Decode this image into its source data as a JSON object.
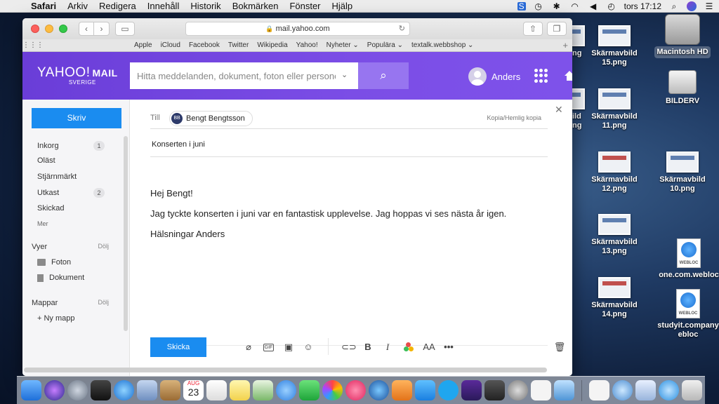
{
  "menubar": {
    "app": "Safari",
    "items": [
      "Arkiv",
      "Redigera",
      "Innehåll",
      "Historik",
      "Bokmärken",
      "Fönster",
      "Hjälp"
    ],
    "clock": "tors 17:12"
  },
  "desktop": {
    "icons": [
      {
        "label1": "Skärmavbild",
        "label2": "15.png"
      },
      {
        "label1": "Skärmavbild",
        "label2": "11.png"
      },
      {
        "label1": "Skärmavbild",
        "label2": "12.png"
      },
      {
        "label1": "Skärmavbild",
        "label2": "13.png"
      },
      {
        "label1": "Skärmavbild",
        "label2": "14.png"
      },
      {
        "label1": "Skärmavbild",
        "label2": "10.png"
      }
    ],
    "partial": [
      "ng",
      "ild",
      "ng"
    ],
    "drive": "Macintosh HD",
    "external": "BILDERV",
    "webloc1": "one.com.webloc",
    "webloc2_line1": "studyit.company",
    "webloc2_line2": "ebloc",
    "webloc_tag": "WEBLOC"
  },
  "safari": {
    "url": "mail.yahoo.com",
    "favorites": [
      "Apple",
      "iCloud",
      "Facebook",
      "Twitter",
      "Wikipedia",
      "Yahoo!",
      "Nyheter ⌄",
      "Populära ⌄",
      "textalk.webbshop ⌄"
    ]
  },
  "yahoo": {
    "logo": "YAHOO!",
    "logo_mail": "MAIL",
    "logo_sub": "SVERIGE",
    "search_placeholder": "Hitta meddelanden, dokument, foton eller personer",
    "user": "Anders",
    "compose_label": "Skriv",
    "folders": [
      {
        "label": "Inkorg",
        "count": "1"
      },
      {
        "label": "Oläst",
        "count": ""
      },
      {
        "label": "Stjärnmärkt",
        "count": ""
      },
      {
        "label": "Utkast",
        "count": "2"
      },
      {
        "label": "Skickad",
        "count": ""
      }
    ],
    "more": "Mer",
    "views_title": "Vyer",
    "views_hide": "Dölj",
    "views": [
      "Foton",
      "Dokument"
    ],
    "folders_title": "Mappar",
    "folders_hide": "Dölj",
    "new_folder": "+ Ny mapp"
  },
  "compose": {
    "to_label": "Till",
    "recipient": "Bengt Bengtsson",
    "recipient_initials": "BB",
    "cc_label": "Kopia/Hemlig kopia",
    "subject": "Konserten i juni",
    "body": [
      "Hej Bengt!",
      "Jag tyckte konserten i juni var en fantastisk upplevelse. Jag hoppas vi ses nästa år igen.",
      "Hälsningar Anders"
    ],
    "send_label": "Skicka",
    "gif_label": "GIF"
  },
  "dock": {
    "calendar_month": "AUG",
    "calendar_day": "23"
  },
  "colors": {
    "yahoo_purple": "#6a3dd8",
    "button_blue": "#1a8cf0"
  }
}
